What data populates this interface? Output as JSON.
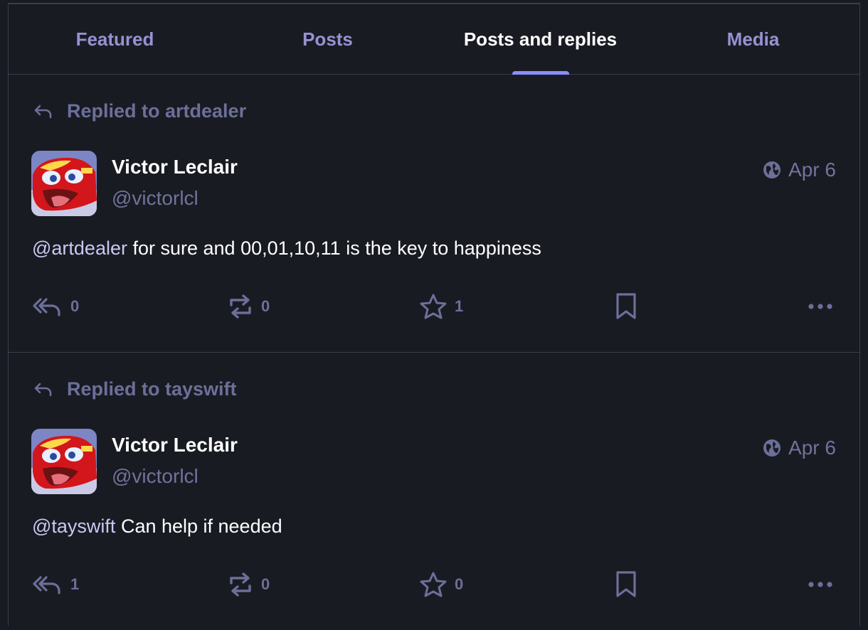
{
  "tabs": [
    {
      "label": "Featured",
      "active": false
    },
    {
      "label": "Posts",
      "active": false
    },
    {
      "label": "Posts and replies",
      "active": true
    },
    {
      "label": "Media",
      "active": false
    }
  ],
  "posts": [
    {
      "replied_to": "Replied to artdealer",
      "author_name": "Victor Leclair",
      "author_handle": "@victorlcl",
      "visibility_icon": "globe-icon",
      "date": "Apr 6",
      "mention": "@artdealer",
      "text": " for sure and 00,01,10,11 is the key to happiness",
      "reply_count": "0",
      "boost_count": "0",
      "favourite_count": "1"
    },
    {
      "replied_to": "Replied to tayswift",
      "author_name": "Victor Leclair",
      "author_handle": "@victorlcl",
      "visibility_icon": "globe-icon",
      "date": "Apr 6",
      "mention": "@tayswift",
      "text": " Can help if needed",
      "reply_count": "1",
      "boost_count": "0",
      "favourite_count": "0"
    }
  ],
  "colors": {
    "background": "#191b22",
    "border": "#393f4f",
    "tab_inactive": "#9891d4",
    "tab_indicator": "#8c8dff",
    "muted": "#6c6f99",
    "text": "#ffffff"
  }
}
